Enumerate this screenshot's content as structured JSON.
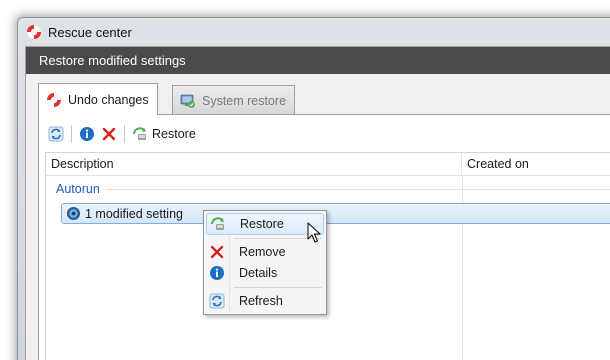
{
  "window": {
    "title": "Rescue center",
    "header": "Restore modified settings"
  },
  "tabs": [
    {
      "label": "Undo changes",
      "icon": "lifebuoy-icon",
      "active": true
    },
    {
      "label": "System restore",
      "icon": "system-restore-icon",
      "active": false
    }
  ],
  "toolbar": {
    "refresh_icon": "refresh-icon",
    "details_icon": "info-icon",
    "remove_icon": "red-x-icon",
    "restore_label": "Restore"
  },
  "list": {
    "columns": [
      "Description",
      "Created on"
    ],
    "group": "Autorun",
    "items": [
      {
        "label": "1 modified setting",
        "created_on": ""
      }
    ]
  },
  "context_menu": {
    "items": [
      {
        "label": "Restore",
        "icon": "restore-icon",
        "highlighted": true
      },
      {
        "label": "Remove",
        "icon": "red-x-icon"
      },
      {
        "label": "Details",
        "icon": "info-icon"
      },
      {
        "label": "Refresh",
        "icon": "refresh-icon"
      }
    ]
  },
  "colors": {
    "header_band": "#4a4a4a",
    "group_text": "#1e5bb5",
    "selection_border": "#84acdd",
    "remove_red": "#d62020",
    "info_blue": "#1a6fc4"
  }
}
